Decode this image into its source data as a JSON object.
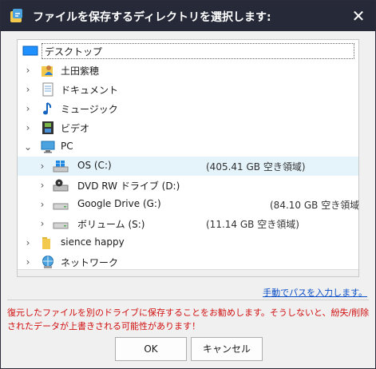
{
  "window": {
    "title": "ファイルを保存するディレクトリを選択します:",
    "close_glyph": "✕"
  },
  "tree": {
    "root": "デスクトップ",
    "items": [
      {
        "label": "土田紫穂",
        "icon": "user-folder-icon"
      },
      {
        "label": "ドキュメント",
        "icon": "documents-icon"
      },
      {
        "label": "ミュージック",
        "icon": "music-note-icon"
      },
      {
        "label": "ビデオ",
        "icon": "video-film-icon"
      },
      {
        "label": "PC",
        "icon": "computer-icon",
        "expanded": true
      },
      {
        "label": "sience happy",
        "icon": "folder-icon"
      },
      {
        "label": "ネットワーク",
        "icon": "network-icon"
      }
    ],
    "drives": [
      {
        "label": "OS (C:)",
        "info": "(405.41 GB 空き領域)",
        "icon": "windows-drive-icon",
        "selected": true
      },
      {
        "label": "DVD RW ドライブ (D:)",
        "info": "",
        "icon": "dvd-drive-icon"
      },
      {
        "label": "Google Drive (G:)",
        "info": "(84.10 GB 空き領域)",
        "icon": "drive-icon"
      },
      {
        "label": "ボリューム (S:)",
        "info": "(11.14 GB 空き領域)",
        "icon": "drive-icon"
      }
    ]
  },
  "manual_path_link": "手動でパスを入力します。",
  "warning_text": "復元したファイルを別のドライブに保存することをお勧めします。そうしないと、紛失/削除されたデータが上書きされる可能性があります！",
  "buttons": {
    "ok": "OK",
    "cancel": "キャンセル"
  },
  "colors": {
    "titlebar": "#262a38",
    "warning": "#d21010",
    "link": "#0a4fc8",
    "selection": "#e5f3fb"
  }
}
